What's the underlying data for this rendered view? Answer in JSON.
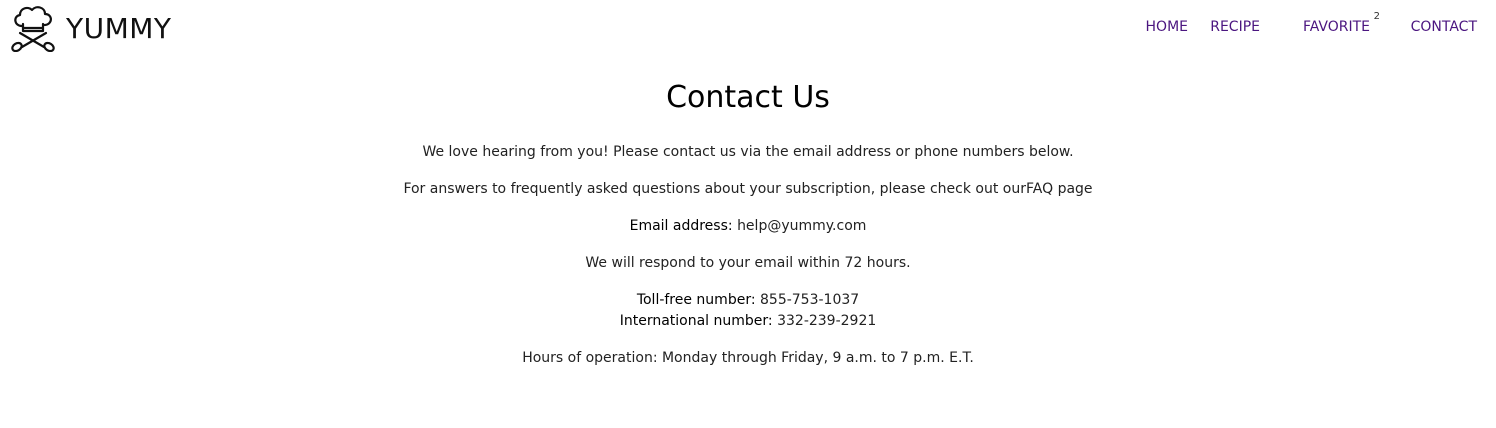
{
  "brand": {
    "name": "YUMMY",
    "logo_icon": "chef-hat-crossed-spoons-icon"
  },
  "nav": {
    "items": [
      {
        "label": "HOME"
      },
      {
        "label": "RECIPE"
      },
      {
        "label": "FAVORITE",
        "badge": "2"
      },
      {
        "label": "CONTACT"
      }
    ],
    "color": "#4b1680"
  },
  "page": {
    "title": "Contact Us",
    "intro": "We love hearing from you! Please contact us via the email address or phone numbers below.",
    "faq_prefix": "For answers to frequently asked questions about your subscription, please check out our",
    "faq_link": "FAQ page",
    "email_label": "Email address:",
    "email_value": "help@yummy.com",
    "response_note": "We will respond to your email within 72 hours.",
    "tollfree_label": "Toll-free number:",
    "tollfree_value": "855-753-1037",
    "intl_label": "International number:",
    "intl_value": "332-239-2921",
    "hours": "Hours of operation: Monday through Friday, 9 a.m. to 7 p.m. E.T."
  }
}
